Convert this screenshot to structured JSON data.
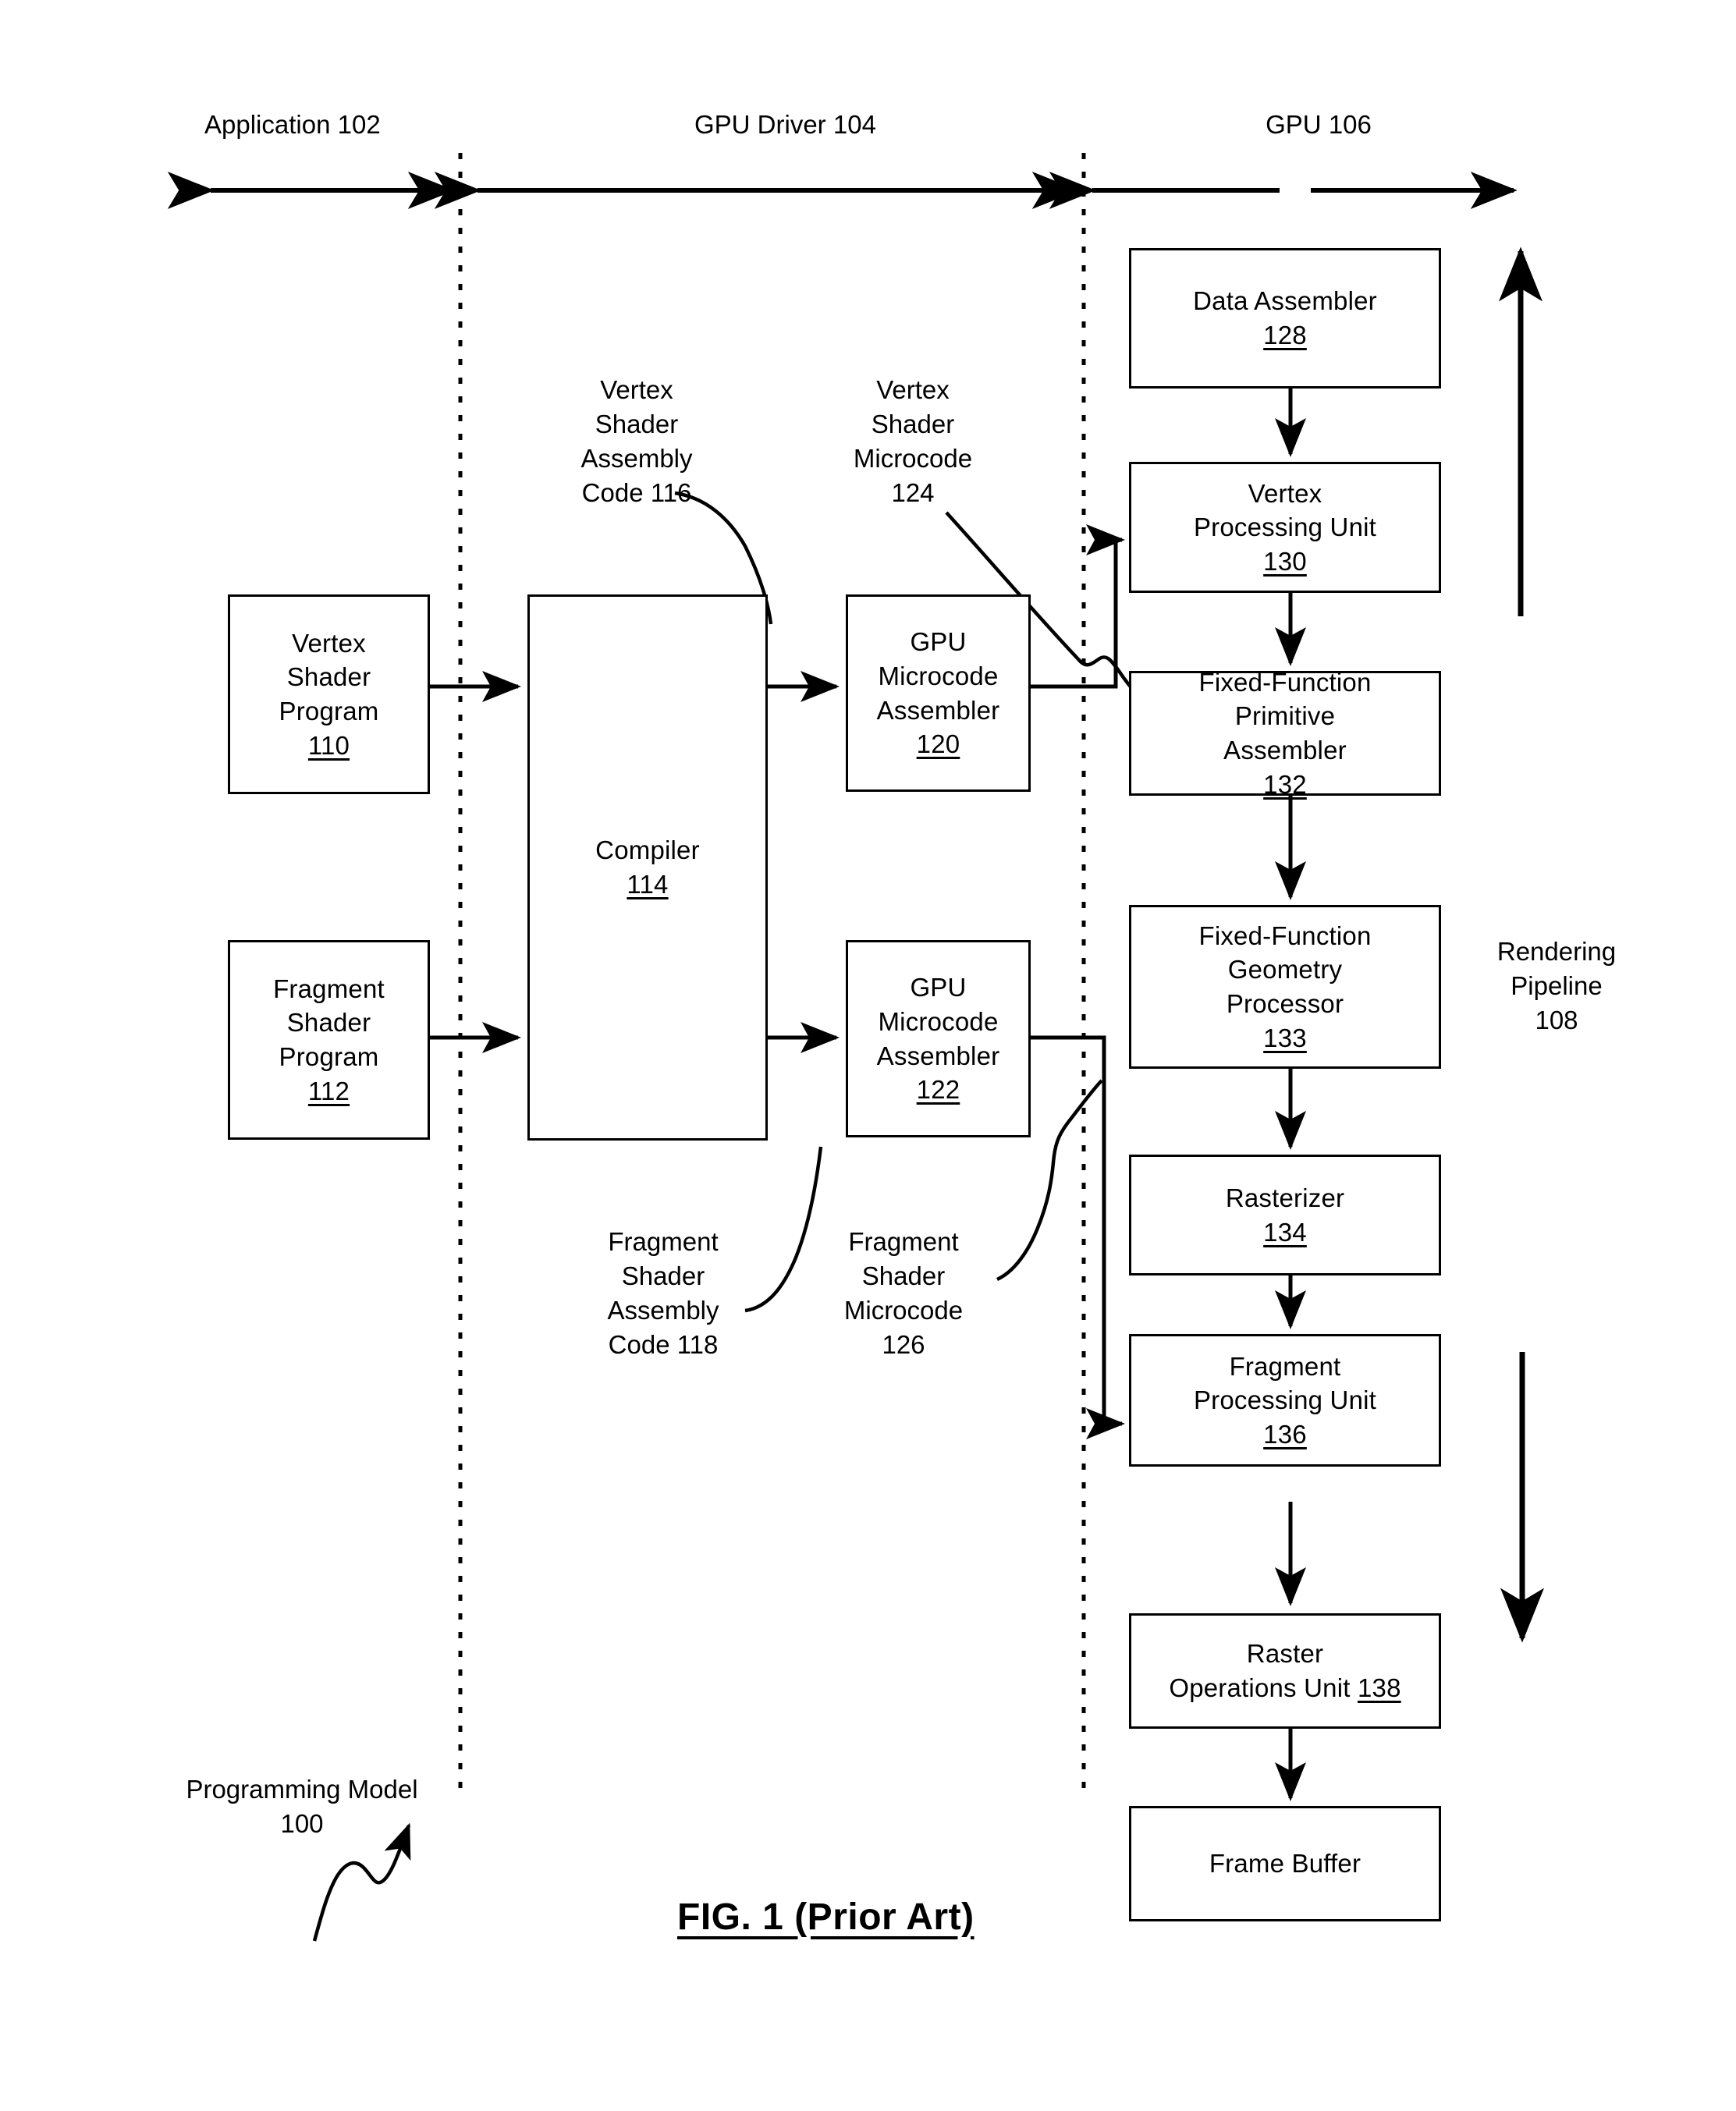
{
  "figure": {
    "caption": "FIG. 1 (Prior Art)"
  },
  "columns": [
    {
      "title": "Application",
      "number": "102"
    },
    {
      "title": "GPU Driver",
      "number": "104"
    },
    {
      "title": "GPU",
      "number": "106"
    }
  ],
  "nodes": {
    "vertex_shader_program": {
      "line1": "Vertex",
      "line2": "Shader",
      "line3": "Program",
      "number": "110"
    },
    "fragment_shader_program": {
      "line1": "Fragment",
      "line2": "Shader",
      "line3": "Program",
      "number": "112"
    },
    "compiler": {
      "line1": "Compiler",
      "number": "114"
    },
    "gpu_microcode_assembler_120": {
      "line1": "GPU",
      "line2": "Microcode",
      "line3": "Assembler",
      "number": "120"
    },
    "gpu_microcode_assembler_122": {
      "line1": "GPU",
      "line2": "Microcode",
      "line3": "Assembler",
      "number": "122"
    },
    "data_assembler": {
      "line1": "Data Assembler",
      "number": "128"
    },
    "vertex_processing_unit": {
      "line1": "Vertex",
      "line2": "Processing Unit",
      "number": "130"
    },
    "fixed_function_primitive_assembler": {
      "line1": "Fixed-Function",
      "line2": "Primitive",
      "line3": "Assembler",
      "number": "132"
    },
    "fixed_function_geometry_processor": {
      "line1": "Fixed-Function",
      "line2": "Geometry",
      "line3": "Processor",
      "number": "133"
    },
    "rasterizer": {
      "line1": "Rasterizer",
      "number": "134"
    },
    "fragment_processing_unit": {
      "line1": "Fragment",
      "line2": "Processing Unit",
      "number": "136"
    },
    "raster_operations_unit": {
      "line1": "Raster",
      "line2_prefix": "Operations Unit ",
      "line2_number": "138"
    },
    "frame_buffer": {
      "line1": "Frame Buffer"
    }
  },
  "annotations": {
    "vertex_shader_assembly_code": {
      "line1": "Vertex",
      "line2": "Shader",
      "line3": "Assembly",
      "line4": "Code 116"
    },
    "vertex_shader_microcode": {
      "line1": "Vertex",
      "line2": "Shader",
      "line3": "Microcode",
      "line4": "124"
    },
    "fragment_shader_assembly_code": {
      "line1": "Fragment",
      "line2": "Shader",
      "line3": "Assembly",
      "line4": "Code 118"
    },
    "fragment_shader_microcode": {
      "line1": "Fragment",
      "line2": "Shader",
      "line3": "Microcode",
      "line4": "126"
    },
    "rendering_pipeline": {
      "line1": "Rendering",
      "line2": "Pipeline",
      "line3": "108"
    },
    "programming_model": {
      "line1": "Programming Model",
      "line2": "100"
    }
  },
  "colors": {
    "stroke": "#000000",
    "background": "#ffffff"
  }
}
